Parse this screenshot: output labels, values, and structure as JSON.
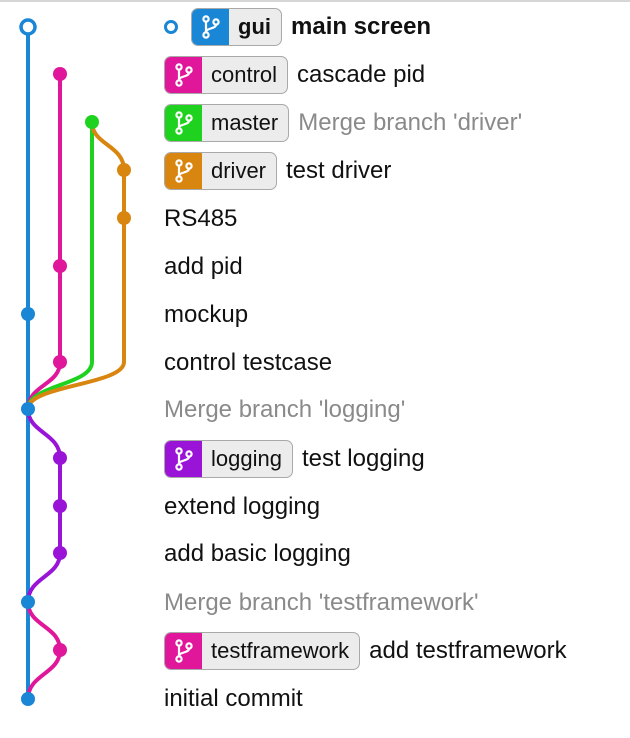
{
  "colors": {
    "blue": "#1a86d6",
    "magenta": "#e0179a",
    "green": "#1fd21f",
    "orange": "#d8860f",
    "purple": "#9a14d8",
    "muted_text": "#8a8a8a"
  },
  "head": {
    "branch": "gui",
    "message": "main screen",
    "icon": "git-branch-icon",
    "color": "#1a86d6"
  },
  "commits": [
    {
      "branch": "control",
      "message": "cascade pid",
      "color": "#e0179a",
      "muted": false
    },
    {
      "branch": "master",
      "message": "Merge branch 'driver'",
      "color": "#1fd21f",
      "muted": true
    },
    {
      "branch": "driver",
      "message": "test driver",
      "color": "#d8860f",
      "muted": false
    },
    {
      "branch": "",
      "message": "RS485",
      "muted": false
    },
    {
      "branch": "",
      "message": "add pid",
      "muted": false
    },
    {
      "branch": "",
      "message": "mockup",
      "muted": false
    },
    {
      "branch": "",
      "message": "control testcase",
      "muted": false
    },
    {
      "branch": "",
      "message": "Merge branch 'logging'",
      "muted": true
    },
    {
      "branch": "logging",
      "message": "test logging",
      "color": "#9a14d8",
      "muted": false
    },
    {
      "branch": "",
      "message": "extend logging",
      "muted": false
    },
    {
      "branch": "",
      "message": "add basic logging",
      "muted": false
    },
    {
      "branch": "",
      "message": "Merge branch 'testframework'",
      "muted": true
    },
    {
      "branch": "testframework",
      "message": "add testframework",
      "color": "#e0179a",
      "muted": false
    },
    {
      "branch": "",
      "message": "initial commit",
      "muted": false
    }
  ]
}
